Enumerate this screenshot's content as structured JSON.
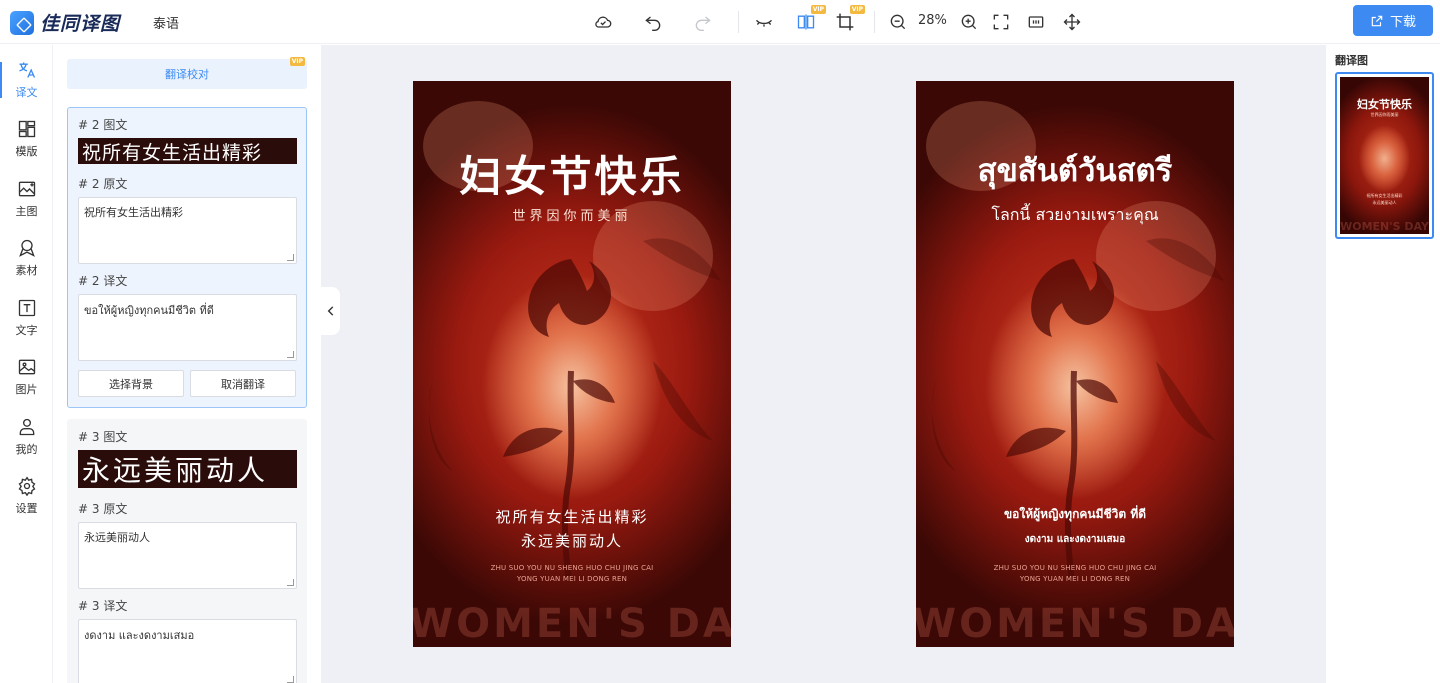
{
  "app": {
    "logo_text": "佳同译图",
    "target_language": "泰语"
  },
  "toolbar": {
    "zoom": "28%",
    "download_label": "下载",
    "vip_badge": "VIP",
    "icons": [
      "cloud-save-icon",
      "undo-icon",
      "redo-icon",
      "hide-original-icon",
      "compare-view-icon",
      "crop-icon",
      "zoom-out-icon",
      "zoom-in-icon",
      "fullscreen-icon",
      "fit-screen-icon",
      "move-icon"
    ]
  },
  "rail": {
    "items": [
      {
        "label": "译文",
        "icon": "translate-icon",
        "active": true
      },
      {
        "label": "模版",
        "icon": "template-icon"
      },
      {
        "label": "主图",
        "icon": "main-image-icon"
      },
      {
        "label": "素材",
        "icon": "material-icon"
      },
      {
        "label": "文字",
        "icon": "text-icon"
      },
      {
        "label": "图片",
        "icon": "picture-icon"
      },
      {
        "label": "我的",
        "icon": "user-icon"
      },
      {
        "label": "设置",
        "icon": "settings-icon"
      }
    ]
  },
  "panel": {
    "proofread_label": "翻译校对",
    "vip_badge": "VIP",
    "cards": [
      {
        "image_label": "# 2 图文",
        "image_text": "祝所有女生活出精彩",
        "source_label": "# 2 原文",
        "source_text": "祝所有女生活出精彩",
        "target_label": "# 2 译文",
        "target_text": "ขอให้ผู้หญิงทุกคนมีชีวิต  ที่ดี",
        "select_bg_label": "选择背景",
        "cancel_label": "取消翻译"
      },
      {
        "image_label": "# 3 图文",
        "image_text": "永远美丽动人",
        "source_label": "# 3 原文",
        "source_text": "永远美丽动人",
        "target_label": "# 3 译文",
        "target_text": "งดงาม  และงดงามเสมอ"
      }
    ]
  },
  "original_poster": {
    "title": "妇女节快乐",
    "subtitle": "世界因你而美丽",
    "line1": "祝所有女生活出精彩",
    "line2": "永远美丽动人",
    "pinyin1": "ZHU SUO YOU NU SHENG HUO CHU JING CAI",
    "pinyin2": "YONG YUAN MEI LI DONG REN",
    "watermark": "WOMEN'S DAY"
  },
  "translated_poster": {
    "title": "สุขสันต์วันสตรี",
    "subtitle": "โลกนี้ สวยงามเพราะคุณ",
    "line1": "ขอให้ผู้หญิงทุกคนมีชีวิต ที่ดี",
    "line2": "งดงาม และงดงามเสมอ",
    "pinyin1": "ZHU SUO YOU NU SHENG HUO CHU JING CAI",
    "pinyin2": "YONG YUAN MEI LI DONG REN",
    "watermark": "WOMEN'S DAY"
  },
  "thumbnails": {
    "title": "翻译图",
    "items": [
      {
        "title": "妇女节快乐",
        "subtitle": "世界因你而美丽",
        "line1": "祝所有女生活出精彩",
        "line2": "永远美丽动人",
        "watermark": "WOMEN'S DAY"
      }
    ]
  }
}
